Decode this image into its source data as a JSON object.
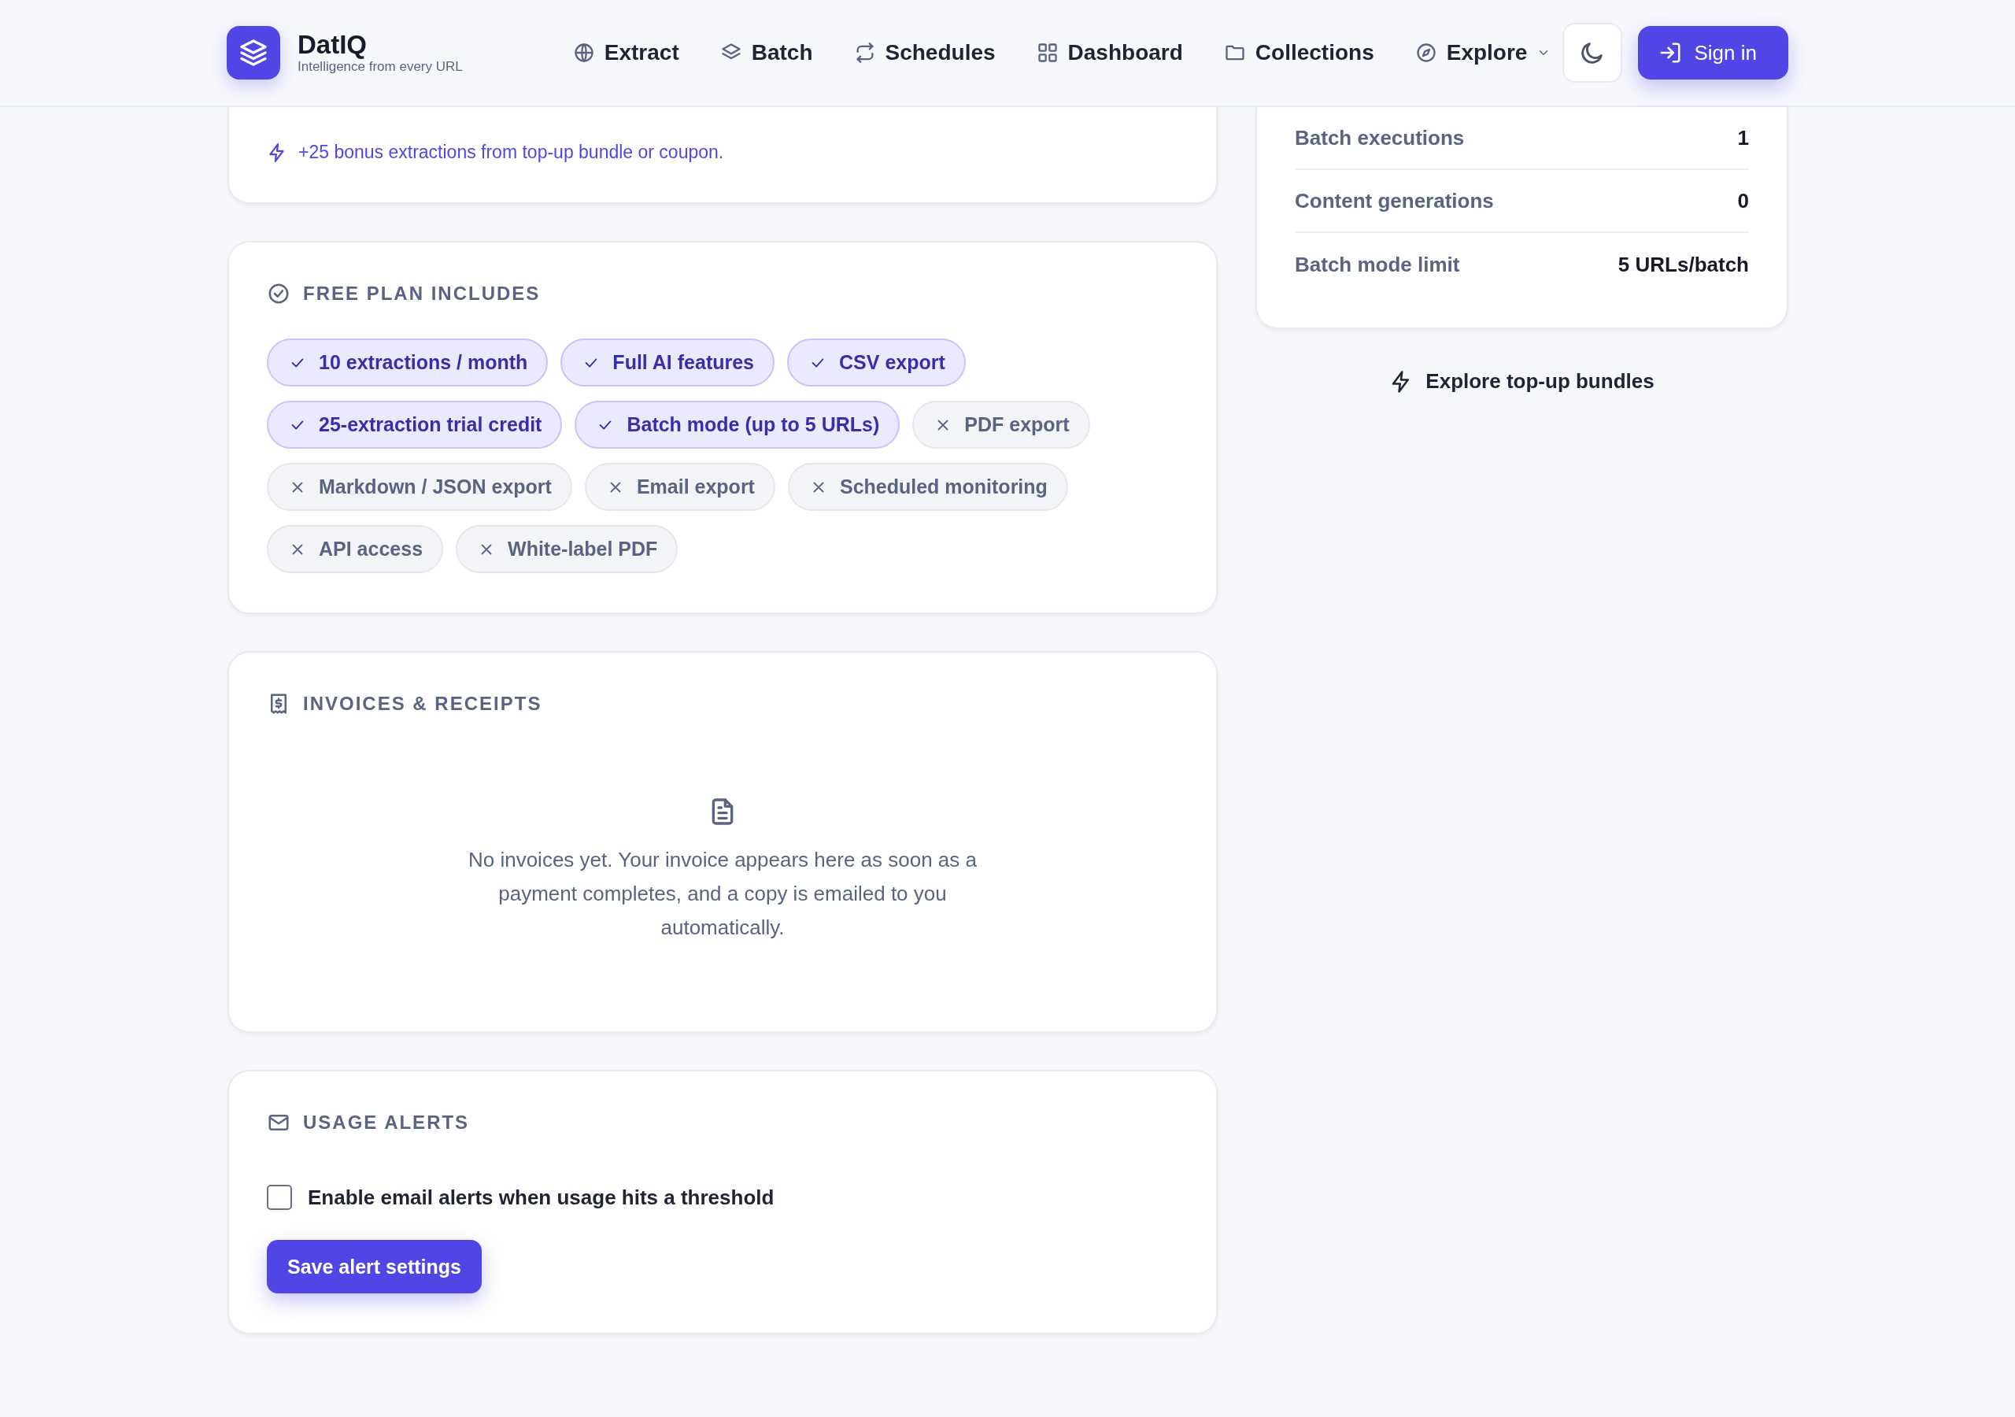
{
  "brand": {
    "name": "DatIQ",
    "tagline": "Intelligence from every URL"
  },
  "nav": [
    {
      "label": "Extract",
      "dropdown": false
    },
    {
      "label": "Batch",
      "dropdown": false
    },
    {
      "label": "Schedules",
      "dropdown": false
    },
    {
      "label": "Dashboard",
      "dropdown": false
    },
    {
      "label": "Collections",
      "dropdown": false
    },
    {
      "label": "Explore",
      "dropdown": true
    }
  ],
  "sign_in": "Sign in",
  "bonus_note": "+25 bonus extractions from top-up bundle or coupon.",
  "plan": {
    "title": "FREE PLAN INCLUDES",
    "features": [
      {
        "label": "10 extractions / month",
        "included": true
      },
      {
        "label": "Full AI features",
        "included": true
      },
      {
        "label": "CSV export",
        "included": true
      },
      {
        "label": "25-extraction trial credit",
        "included": true
      },
      {
        "label": "Batch mode (up to 5 URLs)",
        "included": true
      },
      {
        "label": "PDF export",
        "included": false
      },
      {
        "label": "Markdown / JSON export",
        "included": false
      },
      {
        "label": "Email export",
        "included": false
      },
      {
        "label": "Scheduled monitoring",
        "included": false
      },
      {
        "label": "API access",
        "included": false
      },
      {
        "label": "White-label PDF",
        "included": false
      }
    ]
  },
  "invoices": {
    "title": "INVOICES & RECEIPTS",
    "empty_message": "No invoices yet. Your invoice appears here as soon as a payment completes, and a copy is emailed to you automatically."
  },
  "alerts": {
    "title": "USAGE ALERTS",
    "checkbox": {
      "label": "Enable email alerts when usage hits a threshold",
      "checked": false
    },
    "button": "Save alert settings"
  },
  "usage": [
    {
      "label": "Batch executions",
      "value": "1"
    },
    {
      "label": "Content generations",
      "value": "0"
    },
    {
      "label": "Batch mode limit",
      "value": "5 URLs/batch"
    }
  ],
  "topup_link": "Explore top-up bundles"
}
